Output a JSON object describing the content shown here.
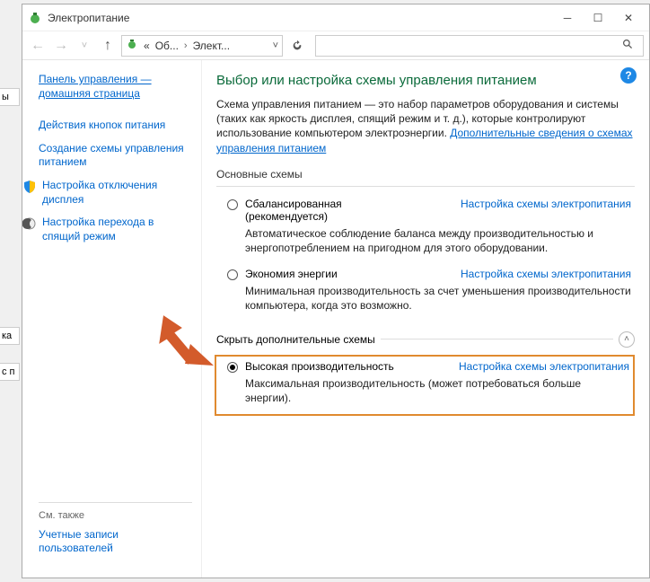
{
  "titlebar": {
    "title": "Электропитание"
  },
  "breadcrumb": {
    "seg1": "Об...",
    "seg2": "Элект...",
    "prefix": "«"
  },
  "sidebar": {
    "home1": "Панель управления —",
    "home2": "домашняя страница",
    "item1": "Действия кнопок питания",
    "item2a": "Создание схемы управления",
    "item2b": "питанием",
    "item3a": "Настройка отключения",
    "item3b": "дисплея",
    "item4a": "Настройка перехода в",
    "item4b": "спящий режим",
    "seealso": "См. также",
    "foot1a": "Учетные записи",
    "foot1b": "пользователей"
  },
  "main": {
    "heading": "Выбор или настройка схемы управления питанием",
    "desc_pre": "Схема управления питанием — это набор параметров оборудования и системы (таких как яркость дисплея, спящий режим и т. д.), которые контролируют использование компьютером электроэнергии. ",
    "desc_link": "Дополнительные сведения о схемах управления питанием",
    "sec1": "Основные схемы",
    "plan1_name": "Сбалансированная",
    "plan1_rec": "(рекомендуется)",
    "plan1_desc": "Автоматическое соблюдение баланса между производительностью и энергопотреблением на пригодном для этого оборудовании.",
    "plan2_name": "Экономия энергии",
    "plan2_desc": "Минимальная производительность за счет уменьшения производительности компьютера, когда это возможно.",
    "sec2": "Скрыть дополнительные схемы",
    "plan3_name": "Высокая производительность",
    "plan3_desc": "Максимальная производительность (может потребоваться больше энергии).",
    "plan_link": "Настройка схемы электропитания"
  },
  "bg": {
    "t1": "ы",
    "t2": "ка",
    "t3": "с п"
  }
}
